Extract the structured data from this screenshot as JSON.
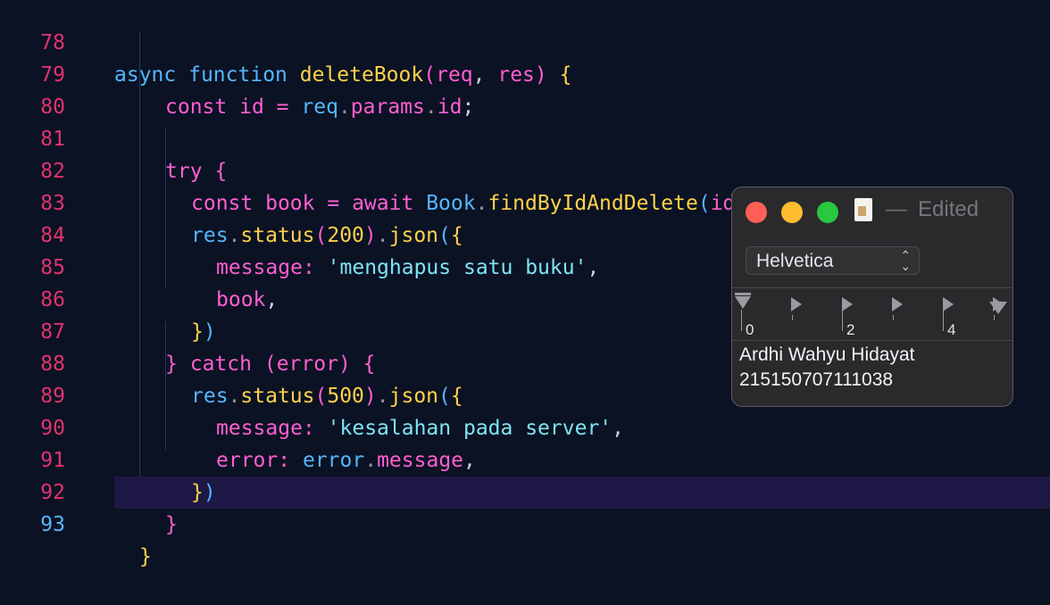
{
  "editor": {
    "line_numbers": [
      "78",
      "79",
      "80",
      "81",
      "82",
      "83",
      "84",
      "85",
      "86",
      "87",
      "88",
      "89",
      "90",
      "91",
      "92",
      "93"
    ],
    "current_line": "93",
    "code": {
      "l78": {
        "async": "async",
        "function": "function",
        "name": "deleteBook",
        "paren_open": "(",
        "req": "req",
        "comma": ", ",
        "res": "res",
        "paren_close": ")",
        "brace": "{"
      },
      "l79": {
        "const": "const",
        "id": "id",
        "eq": "=",
        "req": "req",
        "dot1": ".",
        "params": "params",
        "dot2": ".",
        "id2": "id",
        "semi": ";"
      },
      "l81": {
        "try": "try",
        "brace": "{"
      },
      "l82": {
        "const": "const",
        "book": "book",
        "eq": "=",
        "await": "await",
        "Book": "Book",
        "dot": ".",
        "method": "findByIdAndDelete",
        "po": "(",
        "arg": "id",
        "pc": ")",
        "semi": ";"
      },
      "l83": {
        "res": "res",
        "d1": ".",
        "status": "status",
        "po": "(",
        "num": "200",
        "pc": ")",
        "d2": ".",
        "json": "json",
        "po2": "(",
        "brace": "{"
      },
      "l84": {
        "key": "message",
        "colon": ":",
        "str": "'menghapus satu buku'",
        "comma": ","
      },
      "l85": {
        "key": "book",
        "comma": ","
      },
      "l86": {
        "brace": "}",
        "pc": ")"
      },
      "l87": {
        "brace1": "}",
        "catch": "catch",
        "po": "(",
        "err": "error",
        "pc": ")",
        "brace2": "{"
      },
      "l88": {
        "res": "res",
        "d1": ".",
        "status": "status",
        "po": "(",
        "num": "500",
        "pc": ")",
        "d2": ".",
        "json": "json",
        "po2": "(",
        "brace": "{"
      },
      "l89": {
        "key": "message",
        "colon": ":",
        "str": "'kesalahan pada server'",
        "comma": ","
      },
      "l90": {
        "key": "error",
        "colon": ":",
        "obj": "error",
        "dot": ".",
        "prop": "message",
        "comma": ","
      },
      "l91": {
        "brace": "}",
        "pc": ")"
      },
      "l92": {
        "brace": "}"
      },
      "l93": {
        "brace": "}"
      }
    }
  },
  "textedit": {
    "title_suffix": "—",
    "status": "Edited",
    "font_name": "Helvetica",
    "font_chevron": "⌃⌄",
    "ruler_numbers": [
      "0",
      "2",
      "4"
    ],
    "document_lines": [
      "Ardhi Wahyu Hidayat",
      "215150707111038"
    ],
    "colors": {
      "close": "#ff5f57",
      "minimize": "#febc2e",
      "zoom": "#28c840"
    }
  },
  "colors": {
    "background": "#0b1223",
    "line_number": "#e0336f",
    "line_number_active": "#55b6ff",
    "keyword": "#ff5fd2",
    "function": "#ffd24a",
    "string": "#7ee4f5",
    "builtin": "#55b6ff"
  }
}
